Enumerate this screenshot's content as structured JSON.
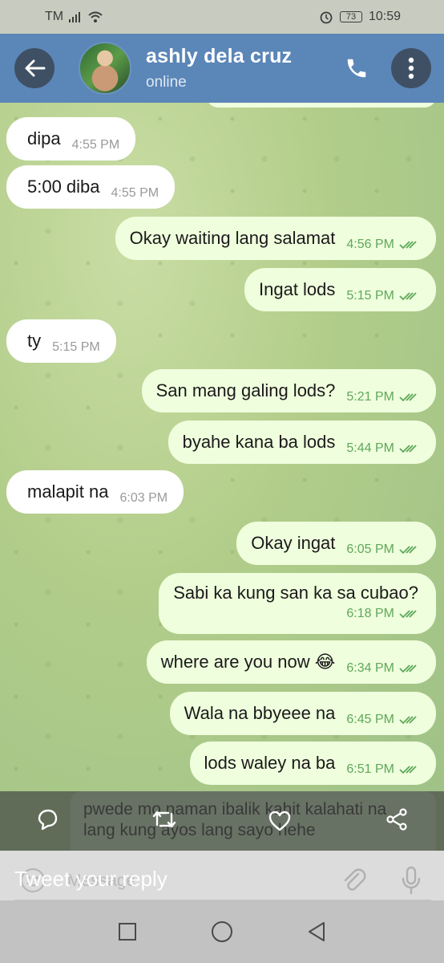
{
  "status_bar": {
    "carrier": "TM",
    "battery": "73",
    "time": "10:59"
  },
  "header": {
    "contact_name": "ashly dela cruz",
    "contact_status": "online"
  },
  "messages": [
    {
      "direction": "in",
      "text": "dipa",
      "time": "4:55 PM"
    },
    {
      "direction": "in",
      "text": "5:00 diba",
      "time": "4:55 PM"
    },
    {
      "direction": "out",
      "text": "Okay waiting lang salamat",
      "time": "4:56 PM"
    },
    {
      "direction": "out",
      "text": "Ingat lods",
      "time": "5:15 PM"
    },
    {
      "direction": "in",
      "text": "ty",
      "time": "5:15 PM"
    },
    {
      "direction": "out",
      "text": "San mang galing lods?",
      "time": "5:21 PM"
    },
    {
      "direction": "out",
      "text": "byahe kana ba lods",
      "time": "5:44 PM"
    },
    {
      "direction": "in",
      "text": "malapit na",
      "time": "6:03 PM"
    },
    {
      "direction": "out",
      "text": "Okay ingat",
      "time": "6:05 PM"
    },
    {
      "direction": "out",
      "text": "Sabi ka kung san ka sa cubao?",
      "time": "6:18 PM"
    },
    {
      "direction": "out",
      "text": "where are you now 😂",
      "time": "6:34 PM"
    },
    {
      "direction": "out",
      "text": "Wala na bbyeee na",
      "time": "6:45 PM"
    },
    {
      "direction": "out",
      "text": "lods waley na ba",
      "time": "6:51 PM"
    }
  ],
  "overlay_message": {
    "text": "pwede mo naman ibalik kahit kalahati na lang kung ayos lang sayo hehe"
  },
  "reply": {
    "placeholder": "Tweet your reply",
    "hidden_input": "Message"
  },
  "colors": {
    "header": "#5b86b8",
    "incoming_bubble": "#ffffff",
    "outgoing_bubble": "#effedd",
    "read_check": "#5ea85a"
  }
}
